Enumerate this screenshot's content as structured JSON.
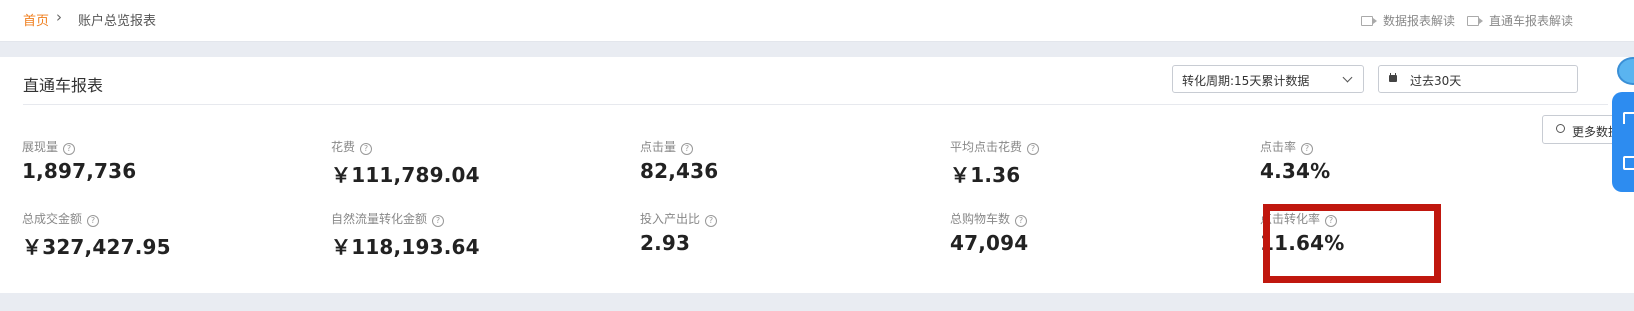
{
  "breadcrumb": {
    "home": "首页",
    "separator": "›",
    "current": "账户总览报表"
  },
  "help_links": [
    {
      "label": "数据报表解读",
      "icon": "video-icon"
    },
    {
      "label": "直通车报表解读",
      "icon": "video-icon"
    }
  ],
  "report": {
    "title": "直通车报表",
    "info_icon": "i",
    "conversion_period": "转化周期:15天累计数据",
    "date_range": "过去30天",
    "more_button": "更多数据"
  },
  "metrics_row1": [
    {
      "label": "展现量",
      "value": "1,897,736"
    },
    {
      "label": "花费",
      "value": "￥111,789.04"
    },
    {
      "label": "点击量",
      "value": "82,436"
    },
    {
      "label": "平均点击花费",
      "value": "￥1.36"
    },
    {
      "label": "点击率",
      "value": "4.34%"
    }
  ],
  "metrics_row2": [
    {
      "label": "总成交金额",
      "value": "￥327,427.95"
    },
    {
      "label": "自然流量转化金额",
      "value": "￥118,193.64"
    },
    {
      "label": "投入产出比",
      "value": "2.93"
    },
    {
      "label": "总购物车数",
      "value": "47,094"
    },
    {
      "label": "点击转化率",
      "value": "11.64%"
    }
  ],
  "question_mark": "?",
  "colors": {
    "accent": "#f07f1f",
    "highlight": "#c0170e",
    "float_panel": "#2d8cf0"
  }
}
